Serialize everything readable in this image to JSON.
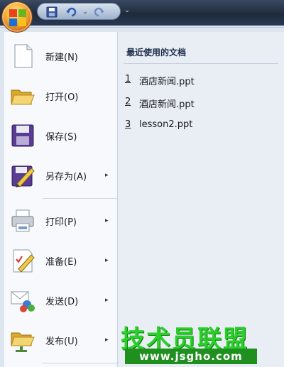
{
  "toolbar": {
    "icons": [
      "save-icon",
      "undo-icon",
      "redo-icon",
      "customize-toolbar-icon"
    ],
    "undo_arrow": "⌄",
    "customize_arrow": "⌄"
  },
  "office_menu": {
    "left_items": [
      {
        "label": "新建(N)",
        "icon": "new-document-icon"
      },
      {
        "label": "打开(O)",
        "icon": "open-folder-icon"
      },
      {
        "label": "保存(S)",
        "icon": "floppy-disk-icon"
      },
      {
        "label": "另存为(A)",
        "icon": "save-as-icon",
        "submenu": true
      },
      {
        "label": "打印(P)",
        "icon": "printer-icon",
        "submenu": true
      },
      {
        "label": "准备(E)",
        "icon": "prepare-pencil-icon",
        "submenu": true
      },
      {
        "label": "发送(D)",
        "icon": "send-icon",
        "submenu": true
      },
      {
        "label": "发布(U)",
        "icon": "publish-folder-icon",
        "submenu": true
      }
    ],
    "submenu_arrow": "▸",
    "recent": {
      "title": "最近使用的文档",
      "documents": [
        {
          "num": "1",
          "name": "酒店新闻.ppt"
        },
        {
          "num": "2",
          "name": "酒店新闻.ppt"
        },
        {
          "num": "3",
          "name": "lesson2.ppt"
        }
      ]
    }
  },
  "watermark": {
    "main": "技术员联盟",
    "sub": "www.jsgho.com",
    "colors": {
      "green": "#2bcf2b",
      "pink": "#e64aa0"
    }
  }
}
